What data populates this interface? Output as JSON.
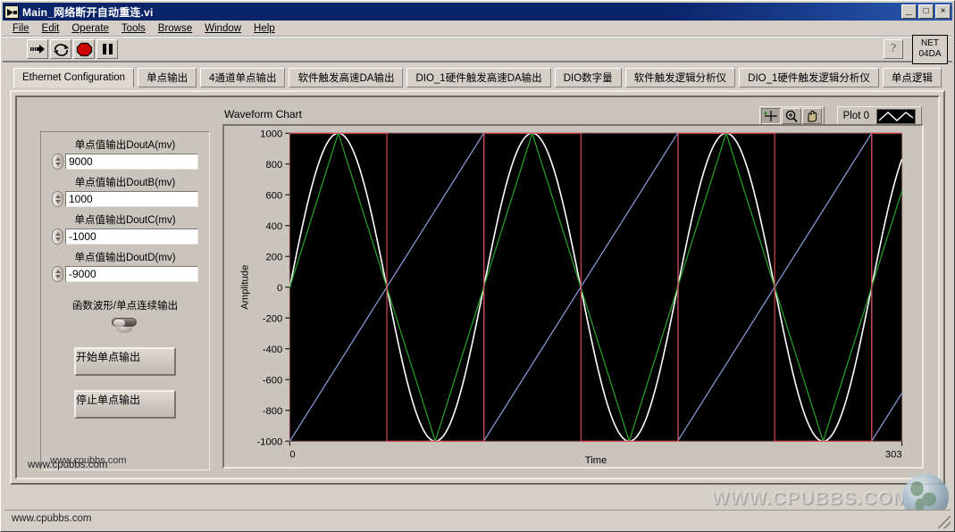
{
  "window": {
    "title": "Main_网络断开自动重连.vi",
    "icon": "labview-vi-icon",
    "buttons": [
      {
        "name": "minimize-button",
        "glyph": "_"
      },
      {
        "name": "maximize-button",
        "glyph": "□"
      },
      {
        "name": "close-button",
        "glyph": "×"
      }
    ]
  },
  "menu": {
    "items": [
      "File",
      "Edit",
      "Operate",
      "Tools",
      "Browse",
      "Window",
      "Help"
    ]
  },
  "toolbar": {
    "buttons": [
      {
        "name": "run-button",
        "icon": "run-arrow-icon",
        "pressed": false
      },
      {
        "name": "run-continuously-button",
        "icon": "run-continuously-icon",
        "pressed": false
      },
      {
        "name": "abort-button",
        "icon": "abort-stop-icon",
        "pressed": false
      },
      {
        "name": "pause-button",
        "icon": "pause-icon",
        "pressed": false
      }
    ],
    "help_button": {
      "name": "help-button",
      "glyph": "?"
    },
    "net_badge": {
      "line1": "NET",
      "line2": "04DA"
    }
  },
  "tabs": {
    "active_index": 0,
    "items": [
      "Ethernet Configuration",
      "单点输出",
      "4通道单点输出",
      "软件触发高速DA输出",
      "DIO_1硬件触发高速DA输出",
      "DIO数字量",
      "软件触发逻辑分析仪",
      "DIO_1硬件触发逻辑分析仪",
      "单点逻辑"
    ]
  },
  "controls": {
    "numerics": [
      {
        "label": "单点值输出DoutA(mv)",
        "value": "9000"
      },
      {
        "label": "单点值输出DoutB(mv)",
        "value": "1000"
      },
      {
        "label": "单点值输出DoutC(mv)",
        "value": "-1000"
      },
      {
        "label": "单点值输出DoutD(mv)",
        "value": "-9000"
      }
    ],
    "switch": {
      "label": "函数波形/单点连续输出",
      "state": "off"
    },
    "start_button": "开始单点输出",
    "stop_button": "停止单点输出",
    "cluster_note": "www.cpubbs.com"
  },
  "chart": {
    "title": "Waveform Chart",
    "tools": [
      {
        "name": "cursor-crosshair-tool",
        "icon": "crosshair-icon",
        "pressed": true
      },
      {
        "name": "zoom-tool",
        "icon": "magnifier-zoom-icon",
        "pressed": false
      },
      {
        "name": "pan-tool",
        "icon": "hand-pan-icon",
        "pressed": false
      }
    ],
    "legend": {
      "name": "Plot 0",
      "sample_color": "#ffffff"
    }
  },
  "chart_data": {
    "type": "line",
    "title": "Waveform Chart",
    "xlabel": "Time",
    "ylabel": "Amplitude",
    "xlim": [
      0,
      303
    ],
    "ylim": [
      -1000,
      1000
    ],
    "xticks": [
      0,
      303
    ],
    "yticks": [
      -1000,
      -800,
      -600,
      -400,
      -200,
      0,
      200,
      400,
      600,
      800,
      1000
    ],
    "grid": false,
    "background": "#000000",
    "cycles": 3.15,
    "period_samples": 96,
    "phase_offset_samples": 0,
    "amplitude": 1000,
    "legend_position": "top-right",
    "series": [
      {
        "name": "Plot 0",
        "waveform": "sine",
        "color": "#ffffff",
        "amplitude": 1000,
        "description": "white sine wave, 3+ cycles across 0..303"
      },
      {
        "name": "Plot 1",
        "waveform": "triangle",
        "color": "#27a52a",
        "amplitude": 1000,
        "description": "green triangle wave, same period and phase as sine"
      },
      {
        "name": "Plot 2",
        "waveform": "sawtooth",
        "color": "#8c9fe0",
        "amplitude": 1000,
        "description": "light blue rising ramp, resets at each period"
      },
      {
        "name": "Plot 3",
        "waveform": "square",
        "color": "#d4484f",
        "amplitude": 1000,
        "description": "red square wave toggling between +1000 and -1000"
      }
    ]
  },
  "footer": {
    "note": "www.cpubbs.com",
    "status": "www.cpubbs.com",
    "watermark": "WWW.CPUBBS.COM"
  }
}
